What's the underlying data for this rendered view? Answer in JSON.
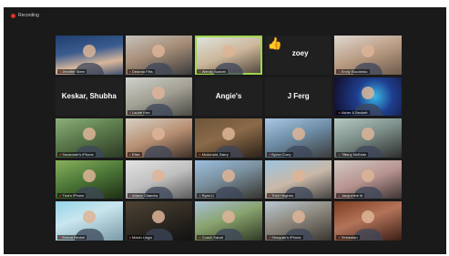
{
  "meeting": {
    "recording_label": "Recording",
    "tiles": [
      {
        "id": "t1",
        "kind": "video",
        "style": "c1",
        "caption": "Jennifer Stern",
        "muted": true
      },
      {
        "id": "t2",
        "kind": "video",
        "style": "c2",
        "caption": "Deanna Fitts",
        "muted": true
      },
      {
        "id": "t3",
        "kind": "video",
        "style": "c3",
        "caption": "Wendy Burkett",
        "muted": true,
        "active": true
      },
      {
        "id": "t4",
        "kind": "emoji-name",
        "emoji": "👍",
        "name": "zoey"
      },
      {
        "id": "t5",
        "kind": "video",
        "style": "c4",
        "caption": "Emily Escobedo",
        "muted": true
      },
      {
        "id": "t6",
        "kind": "name",
        "name": "Keskar, Shubha"
      },
      {
        "id": "t7",
        "kind": "video",
        "style": "c5",
        "caption": "Laurie Kerr",
        "muted": true
      },
      {
        "id": "t8",
        "kind": "name",
        "name": "Angie's"
      },
      {
        "id": "t9",
        "kind": "name",
        "name": "J Ferg"
      },
      {
        "id": "t10",
        "kind": "video",
        "style": "c6",
        "caption": "Asher & Beckett",
        "muted": true
      },
      {
        "id": "t11",
        "kind": "video",
        "style": "c7",
        "caption": "Savannah's iPhone",
        "muted": true
      },
      {
        "id": "t12",
        "kind": "video",
        "style": "c8",
        "caption": "Elise",
        "muted": true
      },
      {
        "id": "t13",
        "kind": "video",
        "style": "c9",
        "caption": "Mcdonald, Barry",
        "muted": true
      },
      {
        "id": "t14",
        "kind": "video",
        "style": "c10",
        "caption": "Byron Curry",
        "muted": true
      },
      {
        "id": "t15",
        "kind": "video",
        "style": "c11",
        "caption": "Tiffany McBride",
        "muted": true
      },
      {
        "id": "t16",
        "kind": "video",
        "style": "c12",
        "caption": "Tina's iPhone",
        "muted": true
      },
      {
        "id": "t17",
        "kind": "video",
        "style": "c13",
        "caption": "Ariana Chandra",
        "muted": true
      },
      {
        "id": "t18",
        "kind": "video",
        "style": "c14",
        "caption": "Ryan Li",
        "muted": true
      },
      {
        "id": "t19",
        "kind": "video",
        "style": "c15",
        "caption": "Trish Hughes",
        "muted": true
      },
      {
        "id": "t20",
        "kind": "video",
        "style": "c16",
        "caption": "Jacqueline M",
        "muted": true
      },
      {
        "id": "t21",
        "kind": "video",
        "style": "c17",
        "caption": "Emma Beckel",
        "muted": true
      },
      {
        "id": "t22",
        "kind": "video",
        "style": "c18",
        "caption": "Mavin Lingal",
        "muted": true
      },
      {
        "id": "t23",
        "kind": "video",
        "style": "c19",
        "caption": "Coach Sarah",
        "muted": true
      },
      {
        "id": "t24",
        "kind": "video",
        "style": "c20",
        "caption": "Shaquan's iPhone",
        "muted": true
      },
      {
        "id": "t25",
        "kind": "video",
        "style": "c21",
        "caption": "Sebastian",
        "muted": true
      }
    ]
  },
  "colors": {
    "window_bg": "#1a1a1a",
    "tile_bg": "#202020",
    "active_speaker": "#9fd64f",
    "muted_mic": "#e23b3b",
    "recording_dot": "#d9342b"
  },
  "icons": {
    "recording": "red dot",
    "muted": "mic-off-icon"
  }
}
